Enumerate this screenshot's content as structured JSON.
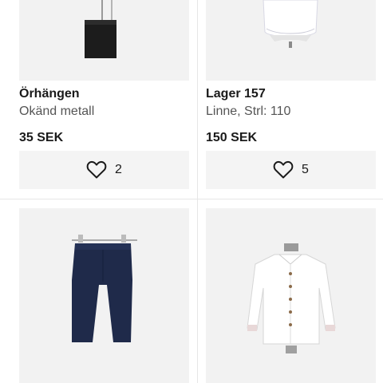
{
  "currency_note": "SEK",
  "items": [
    {
      "title": "Örhängen",
      "subtitle": "Okänd metall",
      "price": "35 SEK",
      "favorites": "2",
      "image": "earring-on-black-stand"
    },
    {
      "title": "Lager 157",
      "subtitle": "Linne, Strl: 110",
      "price": "150 SEK",
      "favorites": "5",
      "image": "white-tank-top-on-mannequin"
    },
    {
      "image": "navy-pants-on-hanger"
    },
    {
      "image": "white-shirt-on-mannequin"
    }
  ],
  "icons": {
    "favorite": "heart-outline-icon"
  }
}
